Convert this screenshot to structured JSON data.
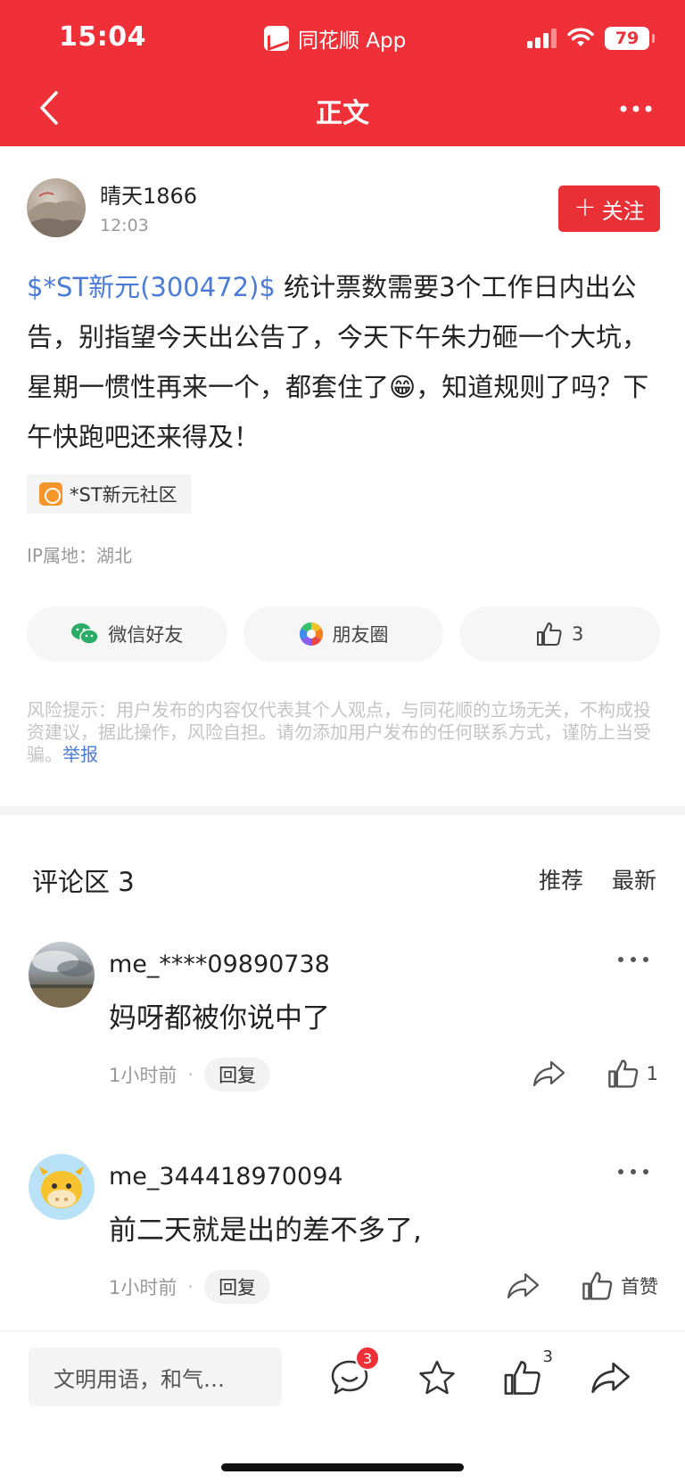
{
  "status_bar": {
    "time": "15:04",
    "source_app": "同花顺 App",
    "battery": "79"
  },
  "nav": {
    "title": "正文"
  },
  "post": {
    "author": "晴天1866",
    "time": "12:03",
    "follow_label": "关注",
    "stock_tag": "$*ST新元(300472)$",
    "body": " 统计票数需要3个工作日内出公告，别指望今天出公告了，今天下午朱力砸一个大坑，星期一惯性再来一个，都套住了😁，知道规则了吗？下午快跑吧还来得及！",
    "community": "*ST新元社区",
    "ip_location": "IP属地：湖北",
    "share_wechat": "微信好友",
    "share_moments": "朋友圈",
    "like_count": "3",
    "risk_note": "风险提示：用户发布的内容仅代表其个人观点，与同花顺的立场无关，不构成投资建议，据此操作，风险自担。请勿添加用户发布的任何联系方式，谨防上当受骗。",
    "report_label": "举报"
  },
  "comments_section": {
    "title": "评论区 3",
    "sort_recommended": "推荐",
    "sort_latest": "最新",
    "items": [
      {
        "user": "me_****09890738",
        "text": "妈呀都被你说中了",
        "time": "1小时前",
        "reply_label": "回复",
        "like_label": "1"
      },
      {
        "user": "me_344418970094",
        "text": "前二天就是出的差不多了,",
        "time": "1小时前",
        "reply_label": "回复",
        "like_label": "首赞"
      }
    ]
  },
  "bottom_bar": {
    "input_placeholder": "文明用语，和气…",
    "comment_badge": "3",
    "like_count": "3"
  },
  "colors": {
    "brand_red": "#ef3038",
    "link_blue": "#4a7bd8",
    "community_orange": "#f6962a"
  },
  "icons": [
    "back-arrow-icon",
    "more-dots-icon",
    "plus-icon",
    "community-icon",
    "wechat-icon",
    "moments-icon",
    "thumbs-up-icon",
    "share-arrow-icon",
    "comment-bubble-icon",
    "star-icon"
  ]
}
